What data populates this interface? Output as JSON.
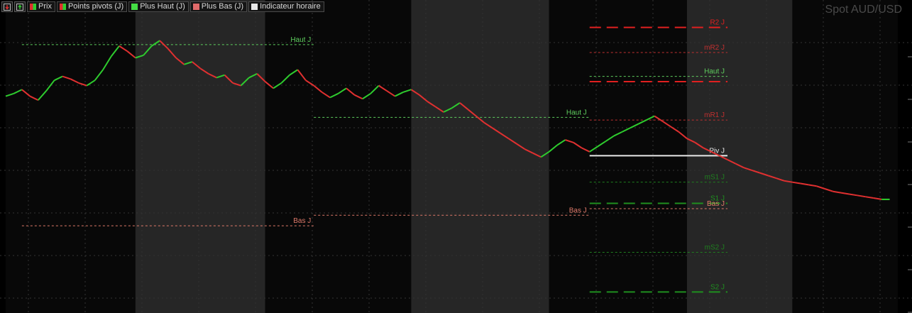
{
  "title": "Spot AUD/USD",
  "toolbar": {
    "icons": [
      "down-arrow-icon",
      "up-arrow-icon"
    ],
    "legend": [
      {
        "label": "Prix",
        "swatch": "split"
      },
      {
        "label": "Points pivots (J)",
        "swatch": "split"
      },
      {
        "label": "Plus Haut (J)",
        "swatch": "green"
      },
      {
        "label": "Plus Bas (J)",
        "swatch": "red"
      },
      {
        "label": "Indicateur horaire",
        "swatch": "white"
      }
    ]
  },
  "colors": {
    "background": "#000000",
    "up": "#2ecc2e",
    "down": "#e03030",
    "high_line": "#5fcf5f",
    "low_line": "#e07a6a",
    "resistance": "#e02020",
    "resistance_mid": "#c03030",
    "support": "#1f8f1f",
    "support_mid": "#1f7f1f",
    "pivot": "#e8e8e8",
    "session_shade": "#262626",
    "session_dark": "#080808"
  },
  "chart_data": {
    "type": "line",
    "series": [
      {
        "name": "Prix",
        "values": [
          -18,
          -20,
          -23,
          -18,
          -15,
          -22,
          -30,
          -33,
          -31,
          -28,
          -26,
          -30,
          -38,
          -48,
          -56,
          -52,
          -47,
          -49,
          -56,
          -60,
          -54,
          -47,
          -42,
          -44,
          -39,
          -35,
          -32,
          -34,
          -28,
          -26,
          -32,
          -35,
          -29,
          -24,
          -28,
          -34,
          -38,
          -30,
          -26,
          -21,
          -17,
          -20,
          -24,
          -19,
          -16,
          -20,
          -26,
          -22,
          -18,
          -21,
          -23,
          -19,
          -14,
          -10,
          -6,
          -9,
          -13,
          -8,
          -3,
          2,
          6,
          10,
          14,
          18,
          22,
          25,
          28,
          24,
          19,
          15,
          17,
          21,
          24,
          20,
          16,
          12,
          9,
          6,
          3,
          0,
          -3,
          1,
          5,
          9,
          14,
          17,
          21,
          24,
          27,
          30,
          33,
          36,
          38,
          40,
          42,
          44,
          46,
          47,
          48,
          49,
          50,
          52,
          54,
          55,
          56,
          57,
          58,
          59,
          60,
          60
        ]
      }
    ],
    "sessions": [
      {
        "x0": 0,
        "x1": 16,
        "style": "dark"
      },
      {
        "x0": 16,
        "x1": 32,
        "style": "shade"
      },
      {
        "x0": 32,
        "x1": 50,
        "style": "dark"
      },
      {
        "x0": 50,
        "x1": 67,
        "style": "shade"
      },
      {
        "x0": 67,
        "x1": 84,
        "style": "dark"
      },
      {
        "x0": 84,
        "x1": 97,
        "style": "shade"
      },
      {
        "x0": 97,
        "x1": 110,
        "style": "dark"
      }
    ],
    "daily_levels": [
      {
        "label": "Haut J",
        "kind": "high",
        "y": -57,
        "x0": 2,
        "x1": 38
      },
      {
        "label": "Bas J",
        "kind": "low",
        "y": 80,
        "x0": 2,
        "x1": 38
      },
      {
        "label": "Haut J",
        "kind": "high",
        "y": -2,
        "x0": 38,
        "x1": 72
      },
      {
        "label": "Bas J",
        "kind": "low",
        "y": 72,
        "x0": 38,
        "x1": 72
      }
    ],
    "pivot_levels": [
      {
        "label": "R2 J",
        "kind": "resistance",
        "y": -70,
        "style": "long-dash"
      },
      {
        "label": "mR2 J",
        "kind": "resistance_mid",
        "y": -51,
        "style": "short-dash"
      },
      {
        "label": "Haut J",
        "kind": "high",
        "y": -33,
        "style": "short-dash"
      },
      {
        "label": "",
        "kind": "resistance",
        "y": -29,
        "style": "long-dash"
      },
      {
        "label": "mR1 J",
        "kind": "resistance_mid",
        "y": 0,
        "style": "short-dash"
      },
      {
        "label": "Piv J",
        "kind": "pivot",
        "y": 27,
        "style": "solid"
      },
      {
        "label": "mS1 J",
        "kind": "support_mid",
        "y": 47,
        "style": "short-dash"
      },
      {
        "label": "S1 J",
        "kind": "support",
        "y": 63,
        "style": "long-dash"
      },
      {
        "label": "Bas J",
        "kind": "low",
        "y": 67,
        "style": "short-dash"
      },
      {
        "label": "mS2 J",
        "kind": "support_mid",
        "y": 100,
        "style": "short-dash"
      },
      {
        "label": "S2 J",
        "kind": "support",
        "y": 130,
        "style": "long-dash"
      }
    ],
    "xlabel": "",
    "ylabel": "",
    "xlim": [
      0,
      110
    ],
    "ylim": [
      -80,
      140
    ],
    "grid": true,
    "legend": "top-left"
  }
}
